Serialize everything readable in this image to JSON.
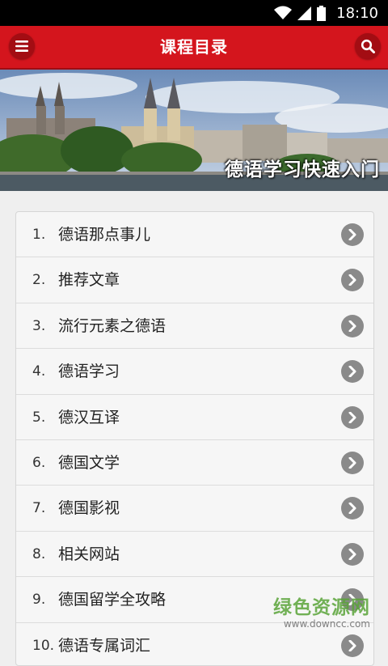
{
  "status": {
    "time": "18:10"
  },
  "app_bar": {
    "title": "课程目录"
  },
  "banner": {
    "caption": "德语学习快速入门"
  },
  "courses": [
    {
      "num": "1.",
      "label": "德语那点事儿"
    },
    {
      "num": "2.",
      "label": "推荐文章"
    },
    {
      "num": "3.",
      "label": "流行元素之德语"
    },
    {
      "num": "4.",
      "label": "德语学习"
    },
    {
      "num": "5.",
      "label": "德汉互译"
    },
    {
      "num": "6.",
      "label": "德国文学"
    },
    {
      "num": "7.",
      "label": "德国影视"
    },
    {
      "num": "8.",
      "label": "相关网站"
    },
    {
      "num": "9.",
      "label": "德国留学全攻略"
    },
    {
      "num": "10.",
      "label": "德语专属词汇"
    }
  ],
  "watermark": {
    "main": "绿色资源网",
    "sub": "www.downcc.com"
  },
  "colors": {
    "app_bar": "#d4151d",
    "status_bar": "#000000",
    "chevron": "#8a8a8a"
  },
  "icons": {
    "menu": "hamburger-icon",
    "search": "search-icon",
    "row": "chevron-right-icon"
  }
}
